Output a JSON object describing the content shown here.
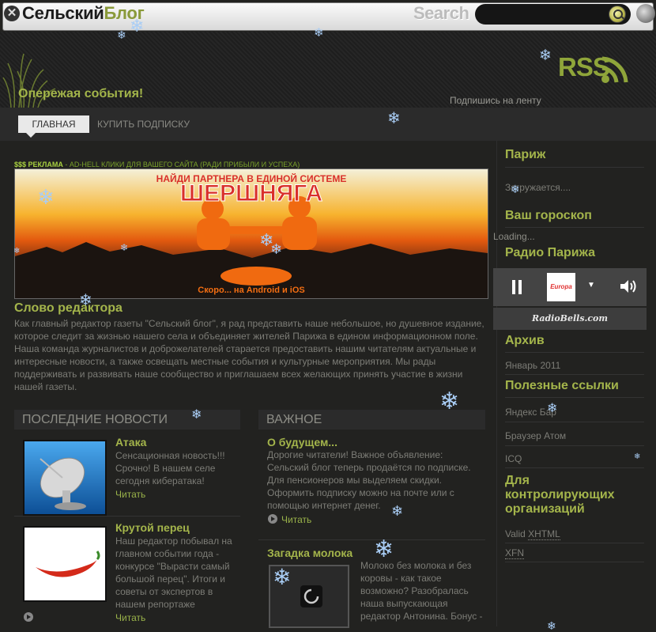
{
  "header": {
    "logo_part1": "Сельский",
    "logo_part2": "Блог",
    "search_label": "Search",
    "search_placeholder": "",
    "tagline": "Опережая события!",
    "rss_label": "RSS",
    "subscribe_text": "Подпишись на ленту"
  },
  "nav": {
    "items": [
      {
        "label": "ГЛАВНАЯ",
        "active": true
      },
      {
        "label": "КУПИТЬ ПОДПИСКУ",
        "active": false
      }
    ]
  },
  "ad": {
    "prefix": "$$$ РЕКЛАМА",
    "text": " - AD-HELL КЛИКИ ДЛЯ ВАШЕГО САЙТА (РАДИ ПРИБЫЛИ И УСПЕХА)",
    "banner_top": "НАЙДИ ПАРТНЕРА В ЕДИНОЙ СИСТЕМЕ",
    "banner_brand": "ШЕРШНЯГА",
    "banner_bottom": "Скоро... на Android и iOS"
  },
  "editor": {
    "title": "Слово редактора",
    "text": "Как главный редактор газеты \"Сельский блог\", я рад представить наше небольшое, но душевное издание, которое следит за жизнью нашего села и объединяет жителей Парижа в едином информационном поле. Наша команда журналистов и доброжелателей старается предоставить нашим читателям актуальные и интересные новости, а также освещать местные события и культурные мероприятия. Мы рады поддерживать и развивать наше сообщество и приглашаем всех желающих принять участие в жизни нашей газеты."
  },
  "latest": {
    "heading": "ПОСЛЕДНИЕ НОВОСТИ",
    "items": [
      {
        "title": "Атака",
        "text": "Сенсационная новость!!! Срочно! В нашем селе сегодня кибератака!",
        "more": "Читать",
        "image_icon": "satellite-dish-icon"
      },
      {
        "title": "Крутой перец",
        "text": "Наш редактор побывал на главном событии года - конкурсе \"Вырасти самый большой перец\". Итоги и советы от экспертов в нашем репортаже",
        "more": "Читать",
        "image_icon": "chili-pepper-icon"
      }
    ]
  },
  "important": {
    "heading": "ВАЖНОЕ",
    "items": [
      {
        "title": "О будущем...",
        "text": "Дорогие читатели! Важное объявление: Сельский блог теперь продаётся по подписке. Для пенсионеров мы выделяем скидки. Оформить подписку можно на почте или с помощью интернет денег.",
        "more": "Читать"
      },
      {
        "title": "Загадка молока",
        "text": "Молоко без молока и без коровы - как такое возможно? Разобралась наша выпускающая редактор Антонина. Бонус -",
        "image_icon": "loading-spinner-icon"
      }
    ]
  },
  "sidebar": {
    "paris_title": "Париж",
    "paris_loading": "Загружается....",
    "horoscope_title": "Ваш гороскоп",
    "horoscope_loading": "Loading...",
    "radio_title": "Радио Парижа",
    "radio_station": "Europa Plus",
    "radio_footer": "RadioBells.com",
    "archive_title": "Архив",
    "archive_items": [
      "Январь 2011"
    ],
    "links_title": "Полезные ссылки",
    "links": [
      "Яндекс Бар",
      "Браузер Атом",
      "ICQ"
    ],
    "orgs_title": "Для контролирующих организаций",
    "orgs_line1_prefix": "Valid ",
    "orgs_line1_abbr": "XHTML",
    "orgs_line2": "XFN"
  },
  "colors": {
    "accent": "#a4b54b",
    "background": "#222220",
    "snow": "#a9cdf5"
  }
}
